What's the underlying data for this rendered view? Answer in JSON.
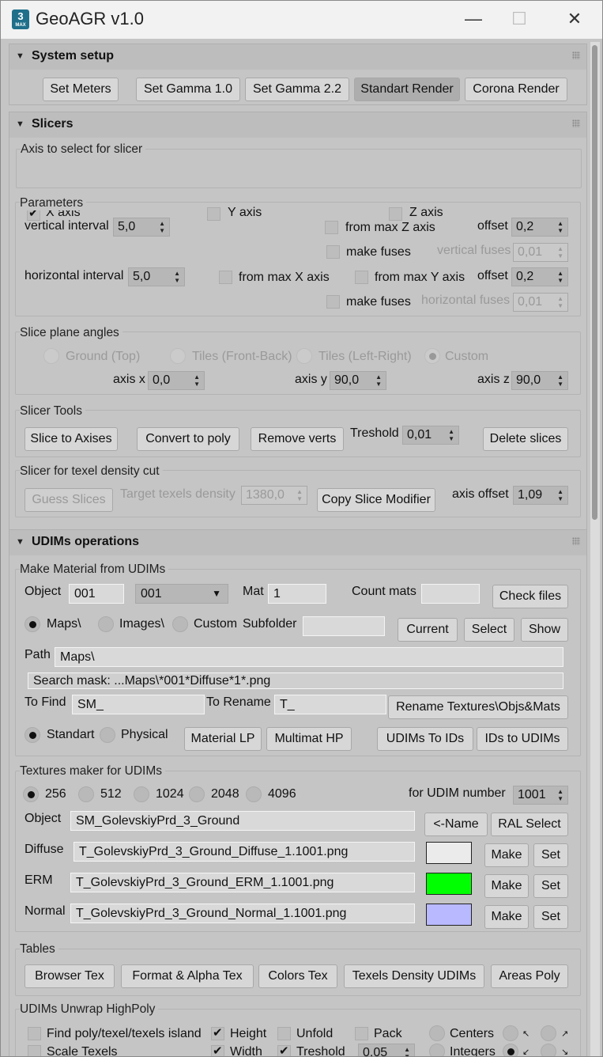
{
  "window": {
    "title": "GeoAGR v1.0",
    "icon": "3ds-max-app-icon",
    "icon_text": "3",
    "icon_subtext": "MAX"
  },
  "system": {
    "title": "System setup",
    "buttons": [
      "Set Meters",
      "Set Gamma 1.0",
      "Set Gamma 2.2",
      "Standart Render",
      "Corona Render"
    ]
  },
  "slicers": {
    "title": "Slicers",
    "axis_group": "Axis to select for slicer",
    "x_axis": "X axis",
    "y_axis": "Y axis",
    "z_axis": "Z axis",
    "params_group": "Parameters",
    "vertical_interval": "vertical interval",
    "vertical_interval_value": "5,0",
    "horizontal_interval": "horizontal interval",
    "horizontal_interval_value": "5,0",
    "from_max_z": "from max Z axis",
    "from_max_x": "from max X axis",
    "from_max_y": "from max Y axis",
    "offset": "offset",
    "offset_z_value": "0,2",
    "offset_y_value": "0,2",
    "make_fuses": "make fuses",
    "vertical_fuses": "vertical fuses",
    "vertical_fuses_value": "0,01",
    "horizontal_fuses": "horizontal fuses",
    "horizontal_fuses_value": "0,01",
    "angles_group": "Slice plane angles",
    "ground": "Ground (Top)",
    "tiles_fb": "Tiles (Front-Back)",
    "tiles_lr": "Tiles (Left-Right)",
    "custom": "Custom",
    "axis_x": "axis x",
    "axis_x_value": "0,0",
    "axis_y": "axis y",
    "axis_y_value": "90,0",
    "axis_z": "axis z",
    "axis_z_value": "90,0",
    "tools_group": "Slicer Tools",
    "slice_to_axises": "Slice to Axises",
    "convert_to_poly": "Convert to poly",
    "remove_verts": "Remove verts",
    "treshold": "Treshold",
    "treshold_value": "0,01",
    "delete_slices": "Delete slices",
    "texel_group": "Slicer for texel density cut",
    "guess_slices": "Guess Slices",
    "target_density": "Target texels density",
    "target_density_value": "1380,0",
    "copy_modifier": "Copy Slice Modifier",
    "axis_offset": "axis offset",
    "axis_offset_value": "1,09"
  },
  "udims": {
    "title": "UDIMs operations",
    "mat_group": "Make Material from UDIMs",
    "object": "Object",
    "object_value": "001",
    "object_combo": "001",
    "mat": "Mat",
    "mat_value": "1",
    "count_mats": "Count mats",
    "count_mats_value": "",
    "check_files": "Check files",
    "maps": "Maps\\",
    "images": "Images\\",
    "custom": "Custom",
    "subfolder": "Subfolder",
    "subfolder_value": "",
    "current": "Current",
    "select": "Select",
    "show": "Show",
    "path": "Path",
    "path_value": "Maps\\",
    "search_mask": "Search mask: ...Maps\\*001*Diffuse*1*.png",
    "to_find": "To Find",
    "to_find_value": "SM_",
    "to_rename": "To Rename",
    "to_rename_value": "T_",
    "rename_btn": "Rename Textures\\Objs&Mats",
    "standart": "Standart",
    "physical": "Physical",
    "material_lp": "Material LP",
    "multimat_hp": "Multimat HP",
    "udims_to_ids": "UDIMs To IDs",
    "ids_to_udims": "IDs to UDIMs",
    "tex_group": "Textures maker for UDIMs",
    "sizes": [
      "256",
      "512",
      "1024",
      "2048",
      "4096"
    ],
    "for_udim": "for UDIM number",
    "udim_value": "1001",
    "tex_object": "Object",
    "tex_object_value": "SM_GolevskiyPrd_3_Ground",
    "name_btn": "<-Name",
    "ral_select": "RAL Select",
    "diffuse": "Diffuse",
    "diffuse_value": "T_GolevskiyPrd_3_Ground_Diffuse_1.1001.png",
    "erm": "ERM",
    "erm_value": "T_GolevskiyPrd_3_Ground_ERM_1.1001.png",
    "normal": "Normal",
    "normal_value": "T_GolevskiyPrd_3_Ground_Normal_1.1001.png",
    "make": "Make",
    "set": "Set",
    "colors": {
      "diffuse": "#ebebeb",
      "erm": "#00ff00",
      "normal": "#b9b9ff"
    },
    "tables_group": "Tables",
    "tables": [
      "Browser Tex",
      "Format & Alpha Tex",
      "Colors Tex",
      "Texels Density UDIMs",
      "Areas Poly"
    ],
    "unwrap_group": "UDIMs Unwrap HighPoly",
    "find_poly": "Find poly/texel/texels island",
    "height": "Height",
    "unfold": "Unfold",
    "pack": "Pack",
    "centers": "Centers",
    "scale_texels": "Scale Texels",
    "width": "Width",
    "treshold": "Treshold",
    "treshold_value": "0.05",
    "integers": "Integers",
    "arrows": {
      "nw": "↖",
      "ne": "↗",
      "sw": "↙",
      "se": "↘"
    }
  }
}
